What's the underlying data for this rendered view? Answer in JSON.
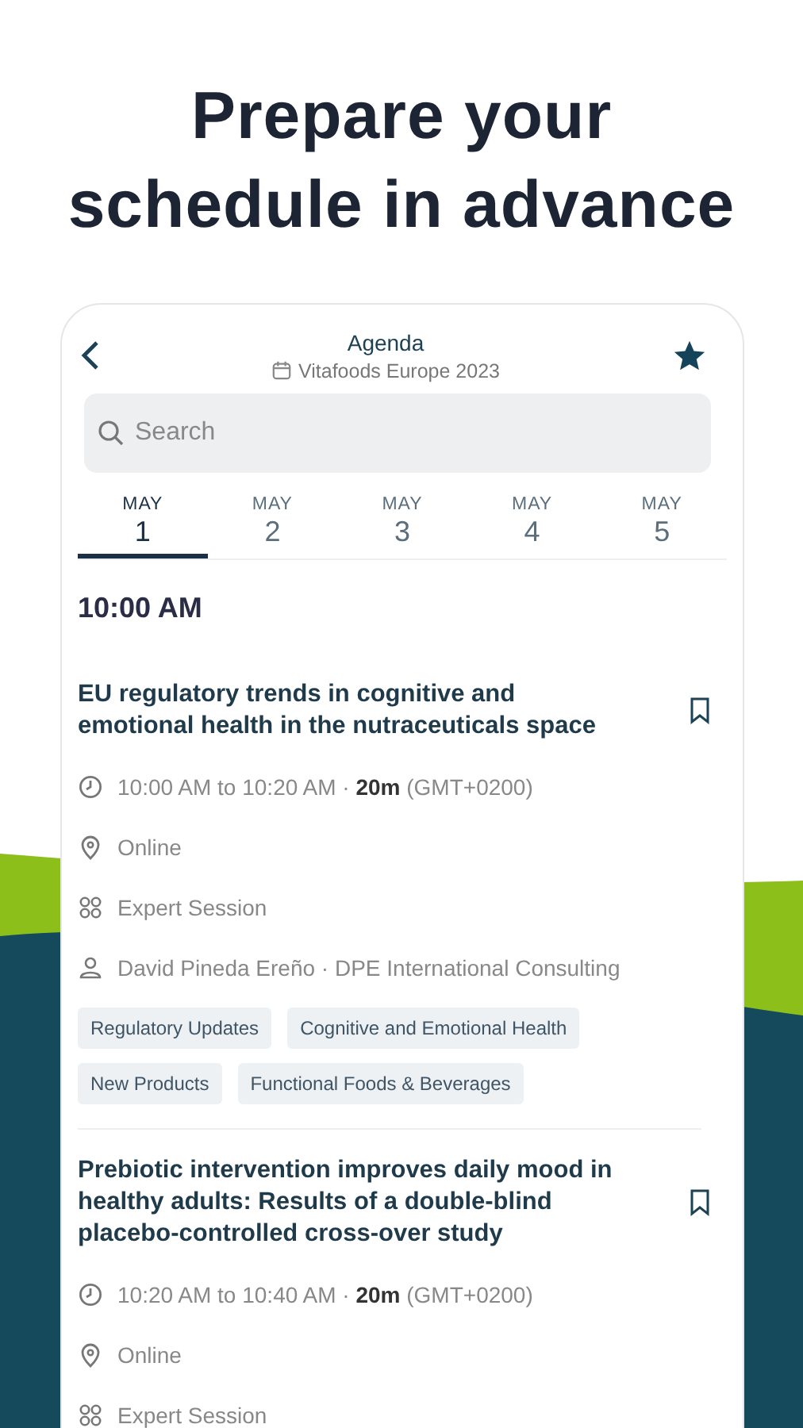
{
  "headline": [
    "Prepare your",
    "schedule in advance"
  ],
  "header": {
    "title": "Agenda",
    "event": "Vitafoods Europe 2023"
  },
  "search": {
    "placeholder": "Search"
  },
  "days": [
    {
      "month": "MAY",
      "day": "1",
      "selected": true
    },
    {
      "month": "MAY",
      "day": "2",
      "selected": false
    },
    {
      "month": "MAY",
      "day": "3",
      "selected": false
    },
    {
      "month": "MAY",
      "day": "4",
      "selected": false
    },
    {
      "month": "MAY",
      "day": "5",
      "selected": false
    }
  ],
  "time_slot": "10:00 AM",
  "sessions": [
    {
      "title": "EU regulatory trends in cognitive and emotional health in the nutraceuticals space",
      "bookmarked": false,
      "time": "10:00 AM to 10:20 AM · **20m** (GMT+0200)",
      "location": "Online",
      "type": "Expert Session",
      "speaker": "David Pineda Ereño · DPE International Consulting",
      "tags": [
        "Regulatory Updates",
        "Cognitive and Emotional Health",
        "New Products",
        "Functional Foods & Beverages"
      ]
    },
    {
      "title": "Prebiotic intervention improves daily mood in healthy adults: Results of a double-blind placebo-controlled cross-over study",
      "bookmarked": false,
      "time": "10:20 AM to 10:40 AM · **20m** (GMT+0200)",
      "location": "Online",
      "type": "Expert Session"
    }
  ]
}
